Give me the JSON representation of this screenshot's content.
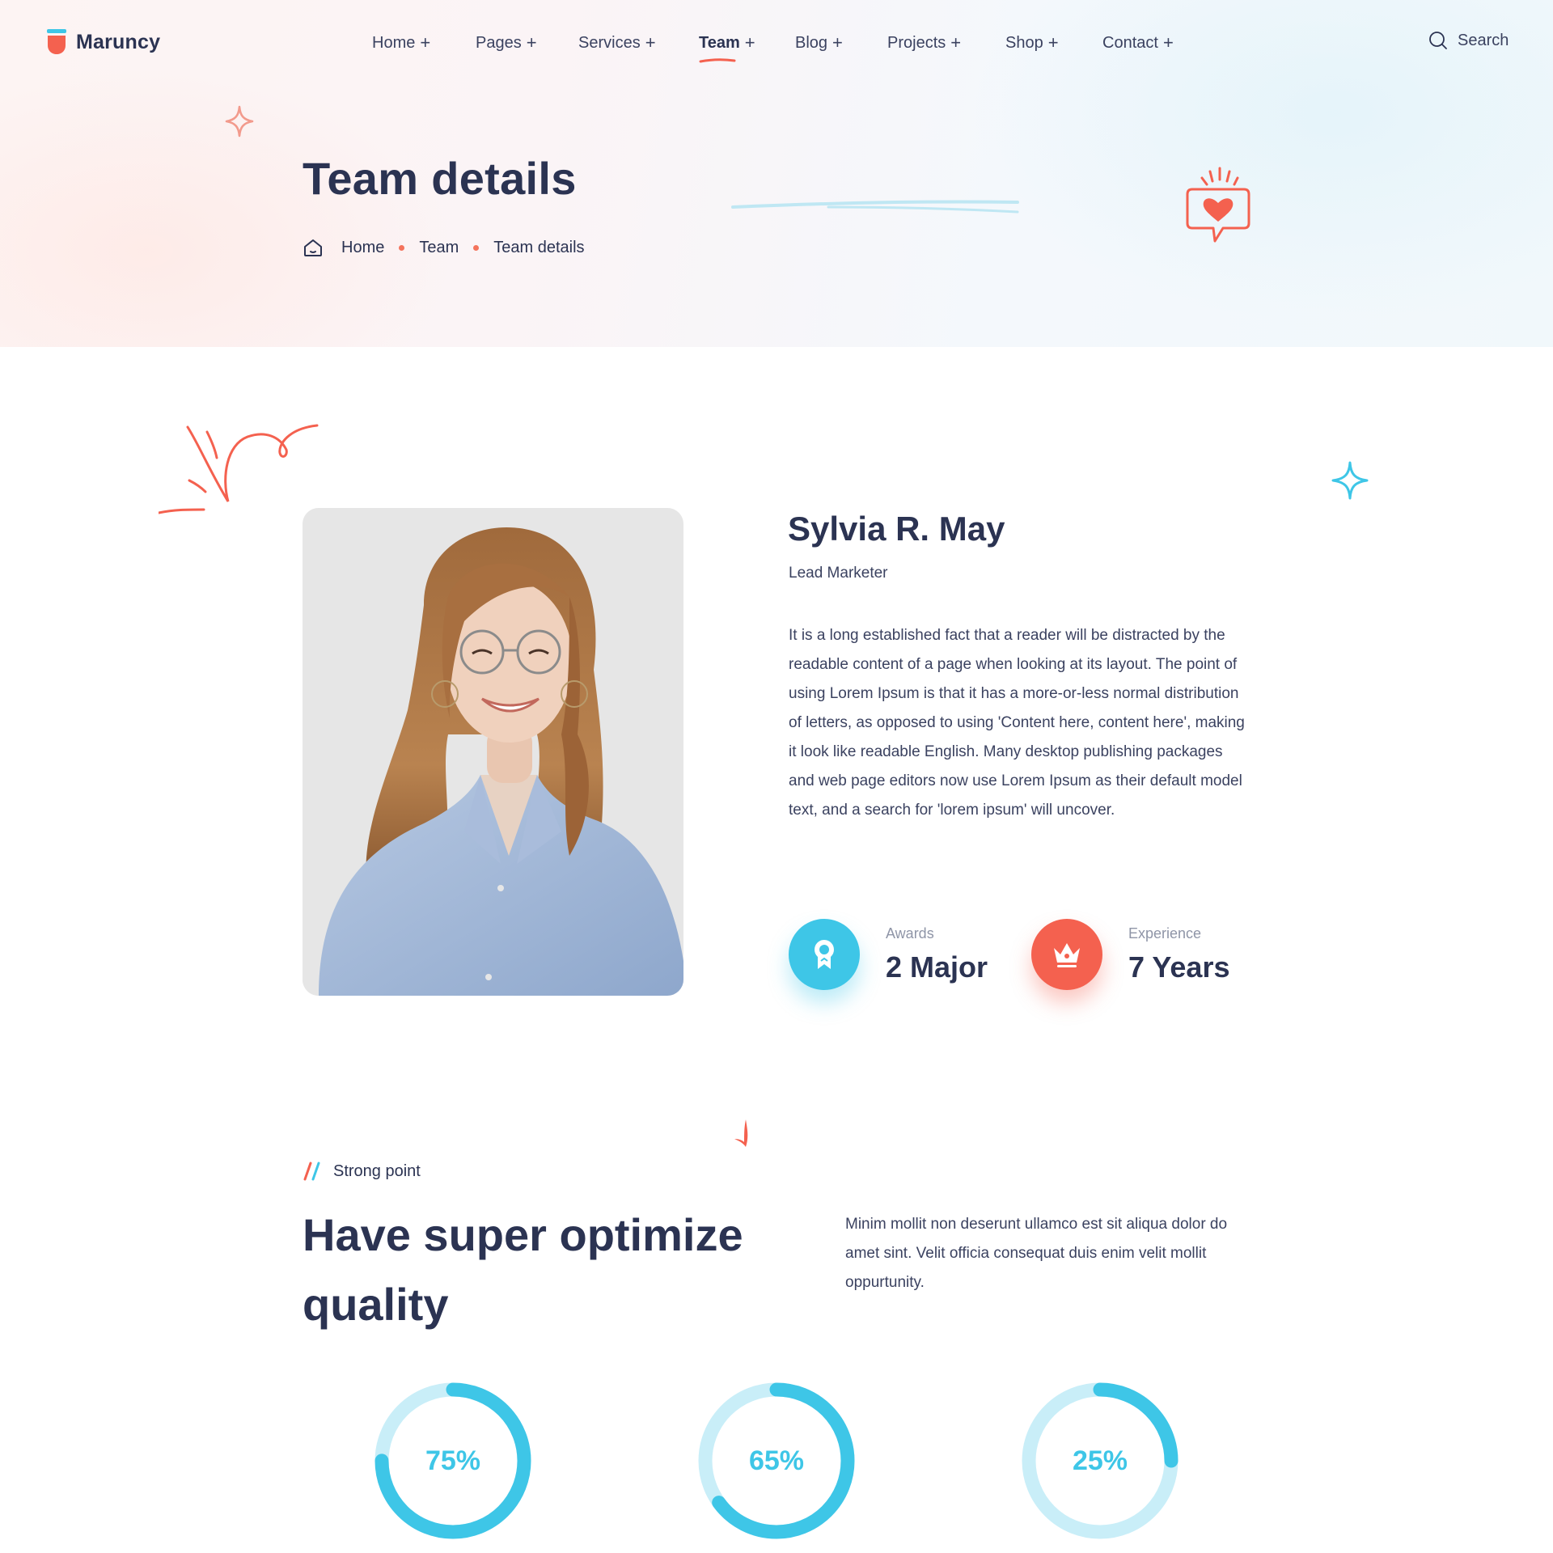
{
  "brand": {
    "name": "Maruncy"
  },
  "nav": {
    "items": [
      {
        "label": "Home",
        "plus": "+"
      },
      {
        "label": "Pages",
        "plus": "+"
      },
      {
        "label": "Services",
        "plus": "+"
      },
      {
        "label": "Team",
        "plus": "+",
        "active": true
      },
      {
        "label": "Blog",
        "plus": "+"
      },
      {
        "label": "Projects",
        "plus": "+"
      },
      {
        "label": "Shop",
        "plus": "+"
      },
      {
        "label": "Contact",
        "plus": "+"
      }
    ],
    "search_label": "Search"
  },
  "hero": {
    "title": "Team details",
    "breadcrumb": [
      "Home",
      "Team",
      "Team details"
    ]
  },
  "profile": {
    "name": "Sylvia R. May",
    "role": "Lead Marketer",
    "bio": "It is a long established fact that a reader will be distracted by the readable content of a page when looking at its layout. The point of using Lorem Ipsum is that it has a more-or-less normal distribution of letters, as opposed to using 'Content here, content here', making it look like readable English. Many desktop publishing packages and web page editors now use Lorem Ipsum as their default model text, and a search for 'lorem ipsum' will uncover.",
    "photo_icon": "portrait-photo",
    "stats": [
      {
        "label": "Awards",
        "value": "2 Major",
        "icon": "award-icon",
        "color": "#3ec6e7"
      },
      {
        "label": "Experience",
        "value": "7 Years",
        "icon": "crown-icon",
        "color": "#f4614f"
      }
    ]
  },
  "strong_point": {
    "tag": "Strong point",
    "title": "Have super optimize quality",
    "description": "Minim mollit non deserunt ullamco est sit aliqua dolor do amet sint. Velit officia consequat duis enim velit mollit oppurtunity.",
    "progress": [
      {
        "label": "75%",
        "value": 0.75
      },
      {
        "label": "65%",
        "value": 0.65
      },
      {
        "label": "25%",
        "value": 0.25
      }
    ]
  },
  "colors": {
    "primary_text": "#2b3352",
    "accent_red": "#f4614f",
    "accent_blue": "#3ec6e7",
    "ring_track": "#c9eef8"
  }
}
